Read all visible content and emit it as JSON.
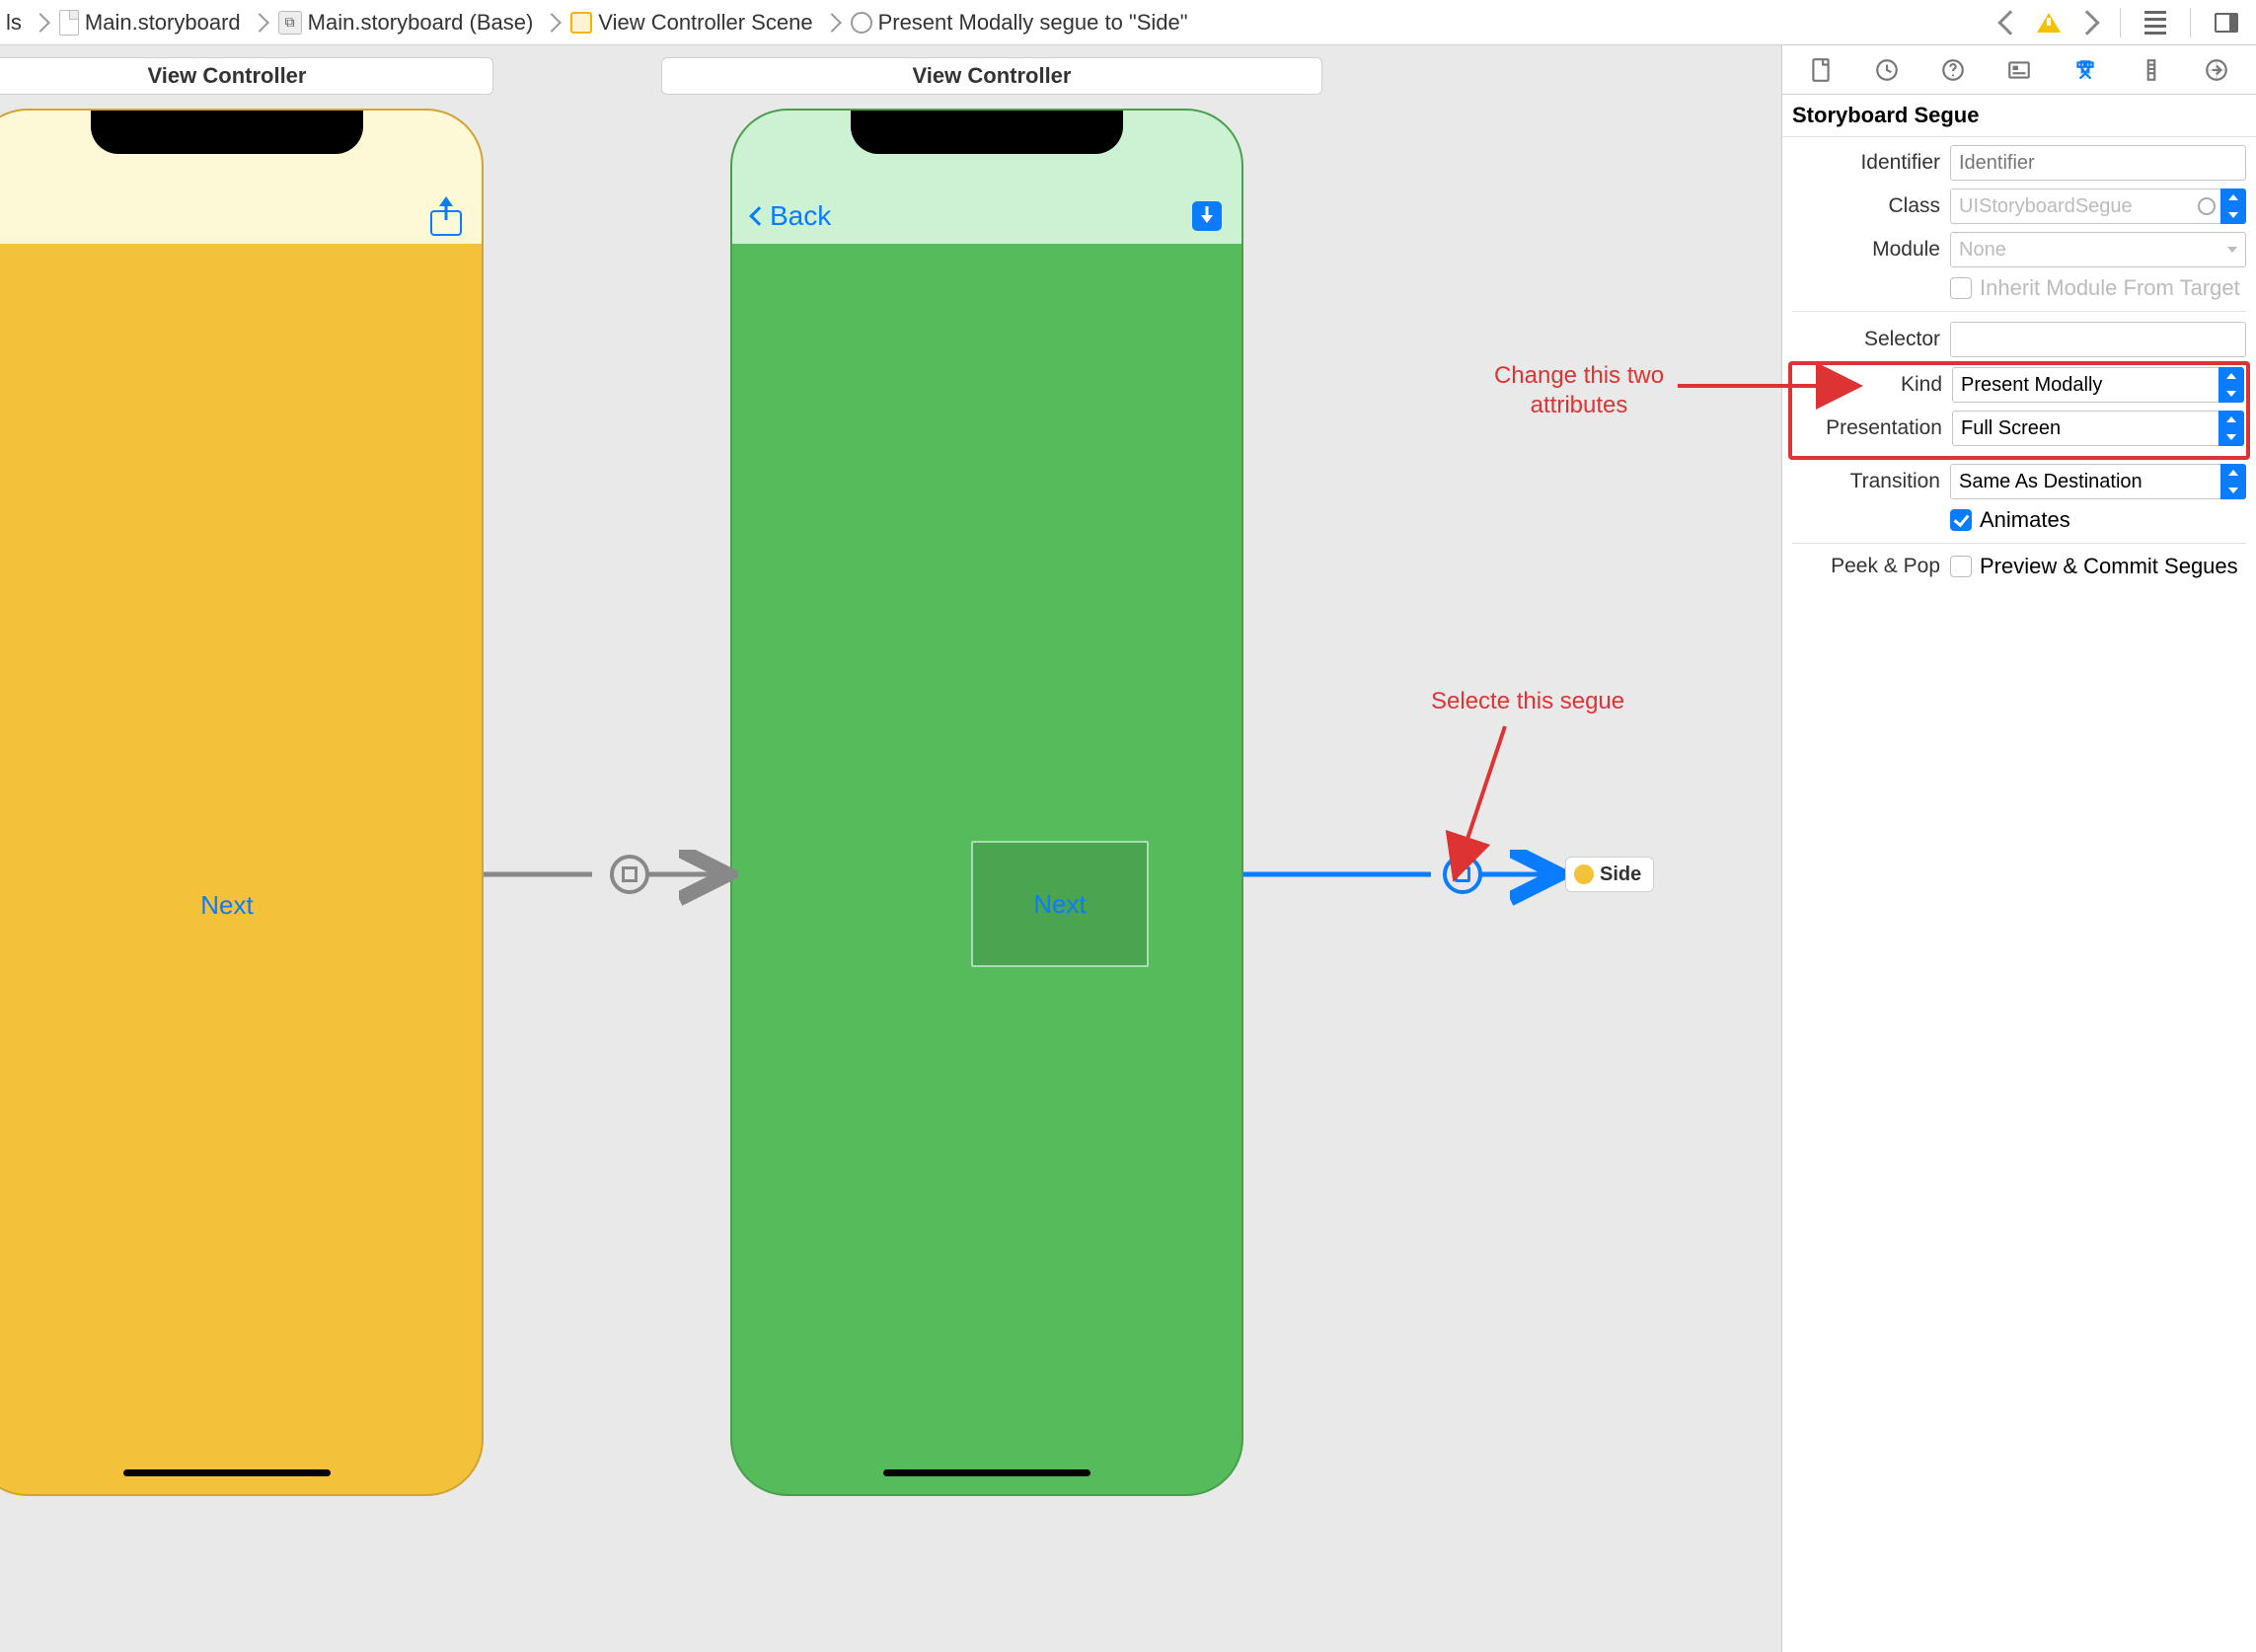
{
  "breadcrumb": {
    "seg0": "ls",
    "seg1": "Main.storyboard",
    "seg2": "Main.storyboard (Base)",
    "seg3": "View Controller Scene",
    "seg4": "Present Modally segue to \"Side\""
  },
  "scene1": {
    "title": "View Controller",
    "button_label": "Next"
  },
  "scene2": {
    "title": "View Controller",
    "back_label": "Back",
    "button_label": "Next"
  },
  "side_node": {
    "label": "Side"
  },
  "annotations": {
    "select_segue": "Selecte this segue",
    "change_attrs_l1": "Change this two",
    "change_attrs_l2": "attributes"
  },
  "inspector": {
    "section_title": "Storyboard Segue",
    "identifier_label": "Identifier",
    "identifier_placeholder": "Identifier",
    "class_label": "Class",
    "class_value": "UIStoryboardSegue",
    "module_label": "Module",
    "module_value": "None",
    "inherit_label": "Inherit Module From Target",
    "selector_label": "Selector",
    "selector_value": "",
    "kind_label": "Kind",
    "kind_value": "Present Modally",
    "presentation_label": "Presentation",
    "presentation_value": "Full Screen",
    "transition_label": "Transition",
    "transition_value": "Same As Destination",
    "animates_label": "Animates",
    "peek_label": "Peek & Pop",
    "peek_option": "Preview & Commit Segues"
  }
}
